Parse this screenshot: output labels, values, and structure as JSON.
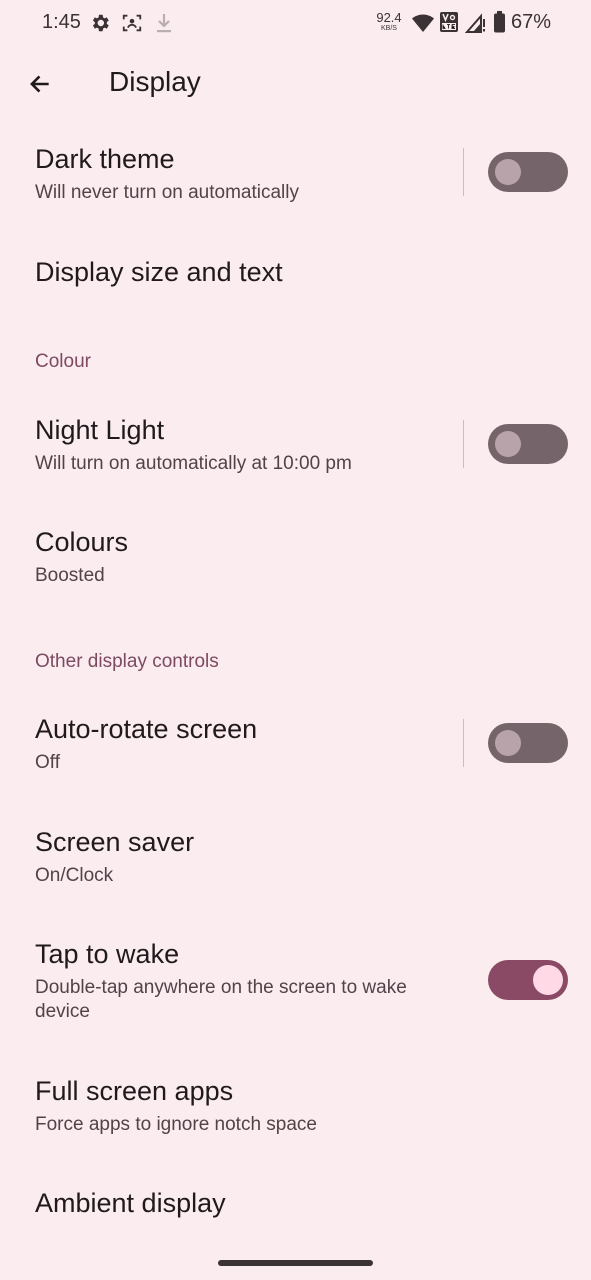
{
  "status_bar": {
    "time": "1:45",
    "net_speed_value": "92.4",
    "net_speed_unit": "KB/S",
    "battery": "67%",
    "icons": [
      "gear-icon",
      "face-scan-icon",
      "download-icon",
      "wifi-icon",
      "volte-icon",
      "signal-icon",
      "battery-icon"
    ]
  },
  "app_bar": {
    "title": "Display",
    "back_icon": "arrow-back-icon"
  },
  "preferences": {
    "dark_theme": {
      "title": "Dark theme",
      "summary": "Will never turn on automatically",
      "enabled": false
    },
    "display_size": {
      "title": "Display size and text"
    },
    "colour_category": "Colour",
    "night_light": {
      "title": "Night Light",
      "summary": "Will turn on automatically at 10:00 pm",
      "enabled": false
    },
    "colours": {
      "title": "Colours",
      "summary": "Boosted"
    },
    "other_category": "Other display controls",
    "auto_rotate": {
      "title": "Auto-rotate screen",
      "summary": "Off",
      "enabled": false
    },
    "screen_saver": {
      "title": "Screen saver",
      "summary": "On/Clock"
    },
    "tap_to_wake": {
      "title": "Tap to wake",
      "summary": "Double-tap anywhere on the screen to wake device",
      "enabled": true
    },
    "full_screen_apps": {
      "title": "Full screen apps",
      "summary": "Force apps to ignore notch space"
    },
    "ambient_display": {
      "title": "Ambient display"
    }
  },
  "colors": {
    "background": "#faecef",
    "accent": "#8a4a66",
    "category": "#7d4a62",
    "switch_off_track": "#756469",
    "switch_on_thumb": "#ffd9e5"
  }
}
